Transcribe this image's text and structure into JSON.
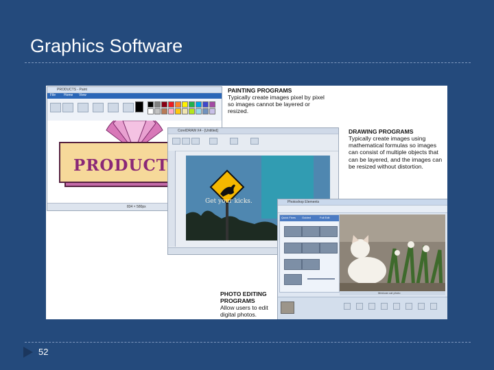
{
  "slide": {
    "title": "Graphics Software",
    "page_number": "52"
  },
  "captions": {
    "painting": {
      "heading": "PAINTING PROGRAMS",
      "body": "Typically create images pixel by pixel so images cannot be layered or resized."
    },
    "drawing": {
      "heading": "DRAWING PROGRAMS",
      "body": "Typically create images using mathematical formulas so images can consist of multiple objects that can be layered, and the images can be resized without distortion."
    },
    "photo": {
      "heading": "PHOTO EDITING PROGRAMS",
      "body": "Allow users to edit digital photos."
    }
  },
  "paint_window": {
    "title": "PRODUCTS - Paint",
    "tabs": [
      "File",
      "Home",
      "View"
    ],
    "status": "834 × 580px",
    "logo_text": "PRODUCTS",
    "colors": [
      "#000000",
      "#7f7f7f",
      "#880015",
      "#ed1c24",
      "#ff7f27",
      "#fff200",
      "#22b14c",
      "#00a2e8",
      "#3f48cc",
      "#a349a4",
      "#ffffff",
      "#c3c3c3",
      "#b97a57",
      "#ffaec9",
      "#ffc90e",
      "#efe4b0",
      "#b5e61d",
      "#99d9ea",
      "#7092be",
      "#c8bfe7"
    ]
  },
  "drawing_window": {
    "title": "CorelDRAW X4 - [Untitled]",
    "poster_text": "Get your kicks."
  },
  "photo_window": {
    "title": "Photoshop Elements",
    "tabs": [
      "Quick Fixes",
      "Guided",
      "Full Edit"
    ],
    "caption_bar": "Mexican cat photo"
  }
}
